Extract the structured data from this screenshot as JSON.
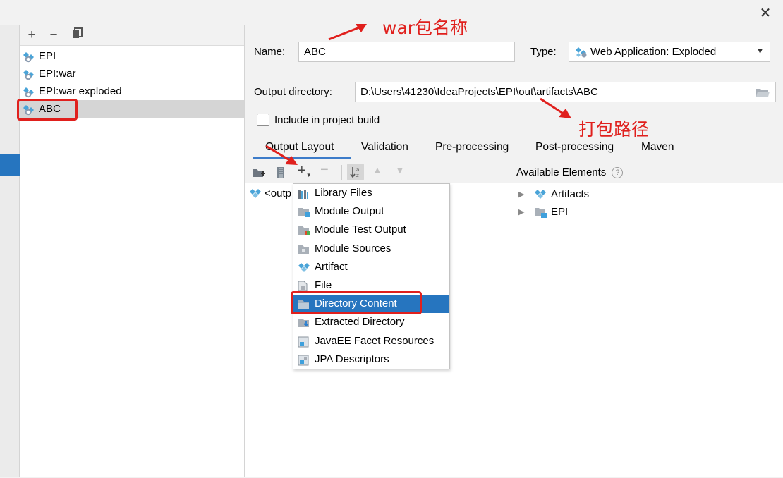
{
  "window": {
    "close_glyph": "✕"
  },
  "artifacts_toolbar": {
    "add": "+",
    "remove": "−",
    "copy": "⧉"
  },
  "artifacts": [
    {
      "label": "EPI"
    },
    {
      "label": "EPI:war"
    },
    {
      "label": "EPI:war exploded"
    },
    {
      "label": "ABC",
      "selected": true
    }
  ],
  "form": {
    "name_label": "Name:",
    "name_value": "ABC",
    "type_label": "Type:",
    "type_value": "Web Application: Exploded",
    "output_dir_label": "Output directory:",
    "output_dir_value": "D:\\Users\\41230\\IdeaProjects\\EPI\\out\\artifacts\\ABC",
    "include_build_label": "Include in project build",
    "include_build_checked": false
  },
  "tabs": [
    "Output Layout",
    "Validation",
    "Pre-processing",
    "Post-processing",
    "Maven"
  ],
  "active_tab": "Output Layout",
  "layout": {
    "root_item": "<outp",
    "available_label": "Available Elements",
    "help_glyph": "?",
    "available_items": [
      "Artifacts",
      "EPI"
    ]
  },
  "add_menu": {
    "items": [
      {
        "label": "Library Files",
        "icon": "library-icon"
      },
      {
        "label": "Module Output",
        "icon": "module-output-icon"
      },
      {
        "label": "Module Test Output",
        "icon": "module-test-output-icon"
      },
      {
        "label": "Module Sources",
        "icon": "module-sources-icon"
      },
      {
        "label": "Artifact",
        "icon": "artifact-icon"
      },
      {
        "label": "File",
        "icon": "file-icon"
      },
      {
        "label": "Directory Content",
        "icon": "folder-icon",
        "highlighted": true
      },
      {
        "label": "Extracted Directory",
        "icon": "extracted-directory-icon"
      },
      {
        "label": "JavaEE Facet Resources",
        "icon": "javaee-icon"
      },
      {
        "label": "JPA Descriptors",
        "icon": "jpa-icon"
      }
    ]
  },
  "annotations": {
    "war_name": "war包名称",
    "package_path": "打包路径"
  },
  "colors": {
    "selection": "#2675bf",
    "annotation": "#e0201d",
    "tab_underline": "#3d7cc9"
  }
}
